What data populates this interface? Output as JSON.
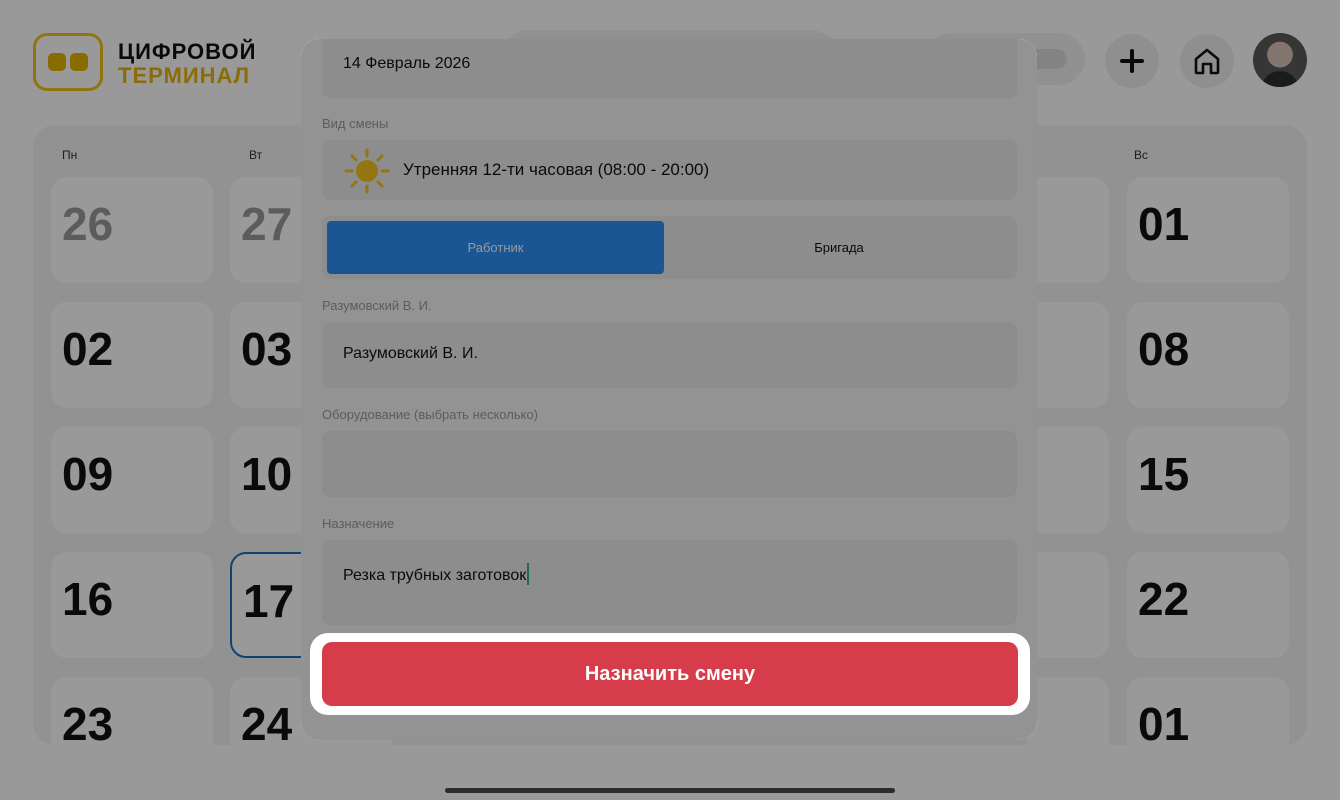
{
  "header": {
    "brand_line1": "ЦИФРОВОЙ",
    "brand_line2": "ТЕРМИНАЛ",
    "add_icon": "plus-icon",
    "home_icon": "home-icon"
  },
  "calendar": {
    "weekdays": {
      "mon": "Пн",
      "tue": "Вт",
      "sun": "Вс"
    },
    "mon_col": [
      "26",
      "02",
      "09",
      "16",
      "23"
    ],
    "tue_col": [
      "27",
      "03",
      "10",
      "17",
      "24"
    ],
    "sun_col": [
      "01",
      "08",
      "15",
      "22",
      "01"
    ],
    "today": "17"
  },
  "modal": {
    "date_value": "14 Февраль 2026",
    "shift_type_label": "Вид смены",
    "shift_type_value": "Утренняя 12-ти часовая (08:00 - 20:00)",
    "shift_icon": "sun-icon",
    "tabs": {
      "worker": "Работник",
      "brigade": "Бригада",
      "active": "worker"
    },
    "employee_label": "Разумовский В. И.",
    "employee_value": "Разумовский В. И.",
    "equipment_label": "Оборудование (выбрать несколько)",
    "equipment_value": "",
    "purpose_label": "Назначение",
    "purpose_value": "Резка трубных заготовок",
    "submit_label": "Назначить смену"
  },
  "colors": {
    "brand_yellow": "#e8b50a",
    "accent_blue": "#2a8ff6",
    "danger_red": "#d73c4a",
    "today_border": "#1f6fc1"
  }
}
